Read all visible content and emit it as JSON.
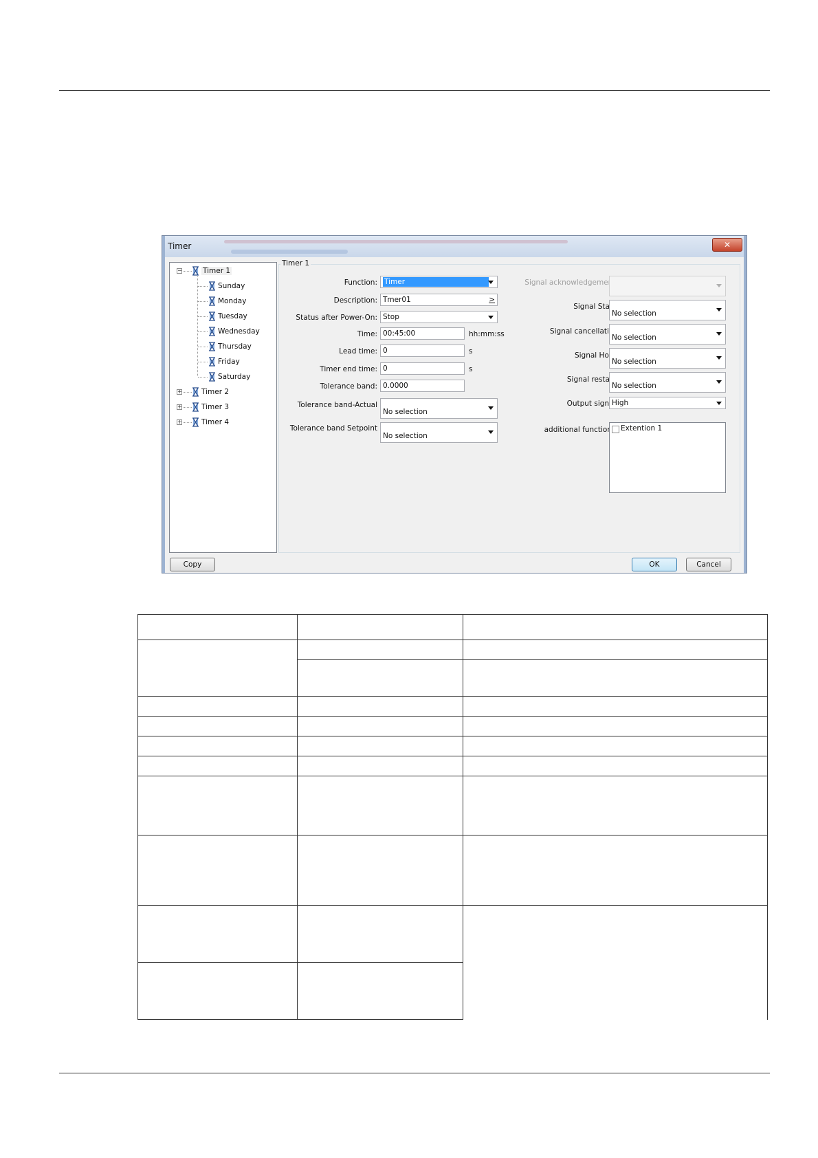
{
  "dialog": {
    "title": "Timer",
    "close_glyph": "✕",
    "group_title": "Timer 1",
    "tree": {
      "timers": [
        "Timer 1",
        "Timer 2",
        "Timer 3",
        "Timer 4"
      ],
      "days": [
        "Sunday",
        "Monday",
        "Tuesday",
        "Wednesday",
        "Thursday",
        "Friday",
        "Saturday"
      ],
      "expanded_glyph": "−",
      "collapsed_glyph": "+"
    },
    "left_fields": {
      "function": {
        "label": "Function:",
        "value": "Timer"
      },
      "description": {
        "label": "Description:",
        "value": "Tmer01",
        "button": ">"
      },
      "status_after_power_on": {
        "label": "Status after Power-On:",
        "value": "Stop"
      },
      "time": {
        "label": "Time:",
        "value": "00:45:00",
        "unit": "hh:mm:ss"
      },
      "lead_time": {
        "label": "Lead time:",
        "value": "0",
        "unit": "s"
      },
      "timer_end_time": {
        "label": "Timer end time:",
        "value": "0",
        "unit": "s"
      },
      "tolerance_band": {
        "label": "Tolerance band:",
        "value": "0.0000"
      },
      "tolerance_band_actual": {
        "label": "Tolerance band-Actual",
        "value": "No selection"
      },
      "tolerance_band_setpoint": {
        "label": "Tolerance band Setpoint",
        "value": "No selection"
      }
    },
    "right_fields": {
      "signal_acknowledgement": {
        "label": "Signal acknowledgement:",
        "value": ""
      },
      "signal_start": {
        "label": "Signal Start:",
        "value": "No selection"
      },
      "signal_cancellation": {
        "label": "Signal cancellation",
        "value": "No selection"
      },
      "signal_hold": {
        "label": "Signal Hold:",
        "value": "No selection"
      },
      "signal_restart": {
        "label": "Signal restart:",
        "value": "No selection"
      },
      "output_signal": {
        "label": "Output signal:",
        "value": "High"
      },
      "additional_functions": {
        "label": "additional functions:",
        "items": [
          "Extention 1"
        ]
      }
    },
    "buttons": {
      "copy": "Copy",
      "ok": "OK",
      "cancel": "Cancel"
    }
  }
}
